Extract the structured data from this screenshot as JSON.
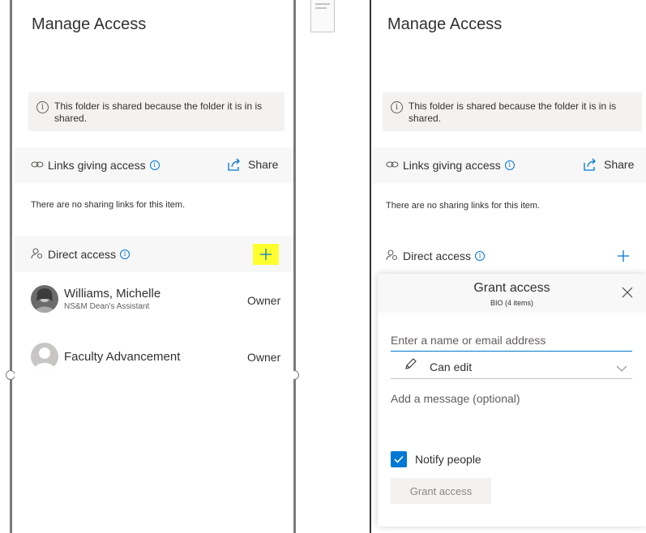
{
  "left_panel": {
    "title": "Manage Access",
    "info_text": "This folder is shared because the folder it is in is shared.",
    "links_label": "Links giving access",
    "share_label": "Share",
    "no_links_text": "There are no sharing links for this item.",
    "direct_access_label": "Direct access",
    "highlight_color": "#ffff30",
    "people": [
      {
        "name": "Williams, Michelle",
        "subtitle": "NS&M Dean's Assistant",
        "role": "Owner"
      },
      {
        "name": "Faculty Advancement",
        "subtitle": "",
        "role": "Owner"
      }
    ]
  },
  "right_panel": {
    "title": "Manage Access",
    "info_text": "This folder is shared because the folder it is in is shared.",
    "links_label": "Links giving access",
    "share_label": "Share",
    "no_links_text": "There are no sharing links for this item.",
    "direct_access_label": "Direct access",
    "grant": {
      "title": "Grant access",
      "subtitle": "BIO (4 items)",
      "input_placeholder": "Enter a name or email address",
      "permission": "Can edit",
      "message_placeholder": "Add a message (optional)",
      "notify_label": "Notify people",
      "notify_checked": true,
      "submit_label": "Grant access"
    }
  },
  "colors": {
    "accent": "#0078d4",
    "text": "#323130",
    "bar_bg": "#f3f2f1"
  }
}
